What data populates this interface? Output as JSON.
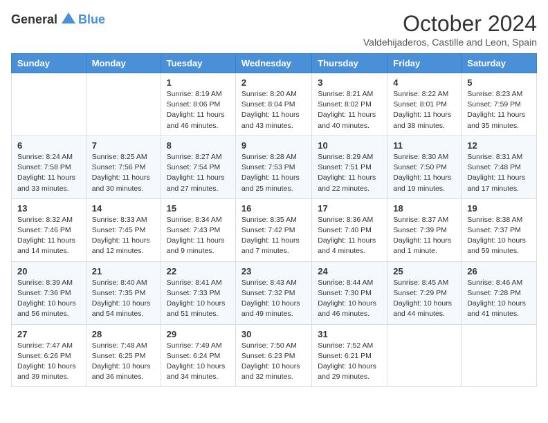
{
  "logo": {
    "general": "General",
    "blue": "Blue"
  },
  "header": {
    "title": "October 2024",
    "subtitle": "Valdehijaderos, Castille and Leon, Spain"
  },
  "days_of_week": [
    "Sunday",
    "Monday",
    "Tuesday",
    "Wednesday",
    "Thursday",
    "Friday",
    "Saturday"
  ],
  "weeks": [
    [
      {
        "day": "",
        "sunrise": "",
        "sunset": "",
        "daylight": ""
      },
      {
        "day": "",
        "sunrise": "",
        "sunset": "",
        "daylight": ""
      },
      {
        "day": "1",
        "sunrise": "Sunrise: 8:19 AM",
        "sunset": "Sunset: 8:06 PM",
        "daylight": "Daylight: 11 hours and 46 minutes."
      },
      {
        "day": "2",
        "sunrise": "Sunrise: 8:20 AM",
        "sunset": "Sunset: 8:04 PM",
        "daylight": "Daylight: 11 hours and 43 minutes."
      },
      {
        "day": "3",
        "sunrise": "Sunrise: 8:21 AM",
        "sunset": "Sunset: 8:02 PM",
        "daylight": "Daylight: 11 hours and 40 minutes."
      },
      {
        "day": "4",
        "sunrise": "Sunrise: 8:22 AM",
        "sunset": "Sunset: 8:01 PM",
        "daylight": "Daylight: 11 hours and 38 minutes."
      },
      {
        "day": "5",
        "sunrise": "Sunrise: 8:23 AM",
        "sunset": "Sunset: 7:59 PM",
        "daylight": "Daylight: 11 hours and 35 minutes."
      }
    ],
    [
      {
        "day": "6",
        "sunrise": "Sunrise: 8:24 AM",
        "sunset": "Sunset: 7:58 PM",
        "daylight": "Daylight: 11 hours and 33 minutes."
      },
      {
        "day": "7",
        "sunrise": "Sunrise: 8:25 AM",
        "sunset": "Sunset: 7:56 PM",
        "daylight": "Daylight: 11 hours and 30 minutes."
      },
      {
        "day": "8",
        "sunrise": "Sunrise: 8:27 AM",
        "sunset": "Sunset: 7:54 PM",
        "daylight": "Daylight: 11 hours and 27 minutes."
      },
      {
        "day": "9",
        "sunrise": "Sunrise: 8:28 AM",
        "sunset": "Sunset: 7:53 PM",
        "daylight": "Daylight: 11 hours and 25 minutes."
      },
      {
        "day": "10",
        "sunrise": "Sunrise: 8:29 AM",
        "sunset": "Sunset: 7:51 PM",
        "daylight": "Daylight: 11 hours and 22 minutes."
      },
      {
        "day": "11",
        "sunrise": "Sunrise: 8:30 AM",
        "sunset": "Sunset: 7:50 PM",
        "daylight": "Daylight: 11 hours and 19 minutes."
      },
      {
        "day": "12",
        "sunrise": "Sunrise: 8:31 AM",
        "sunset": "Sunset: 7:48 PM",
        "daylight": "Daylight: 11 hours and 17 minutes."
      }
    ],
    [
      {
        "day": "13",
        "sunrise": "Sunrise: 8:32 AM",
        "sunset": "Sunset: 7:46 PM",
        "daylight": "Daylight: 11 hours and 14 minutes."
      },
      {
        "day": "14",
        "sunrise": "Sunrise: 8:33 AM",
        "sunset": "Sunset: 7:45 PM",
        "daylight": "Daylight: 11 hours and 12 minutes."
      },
      {
        "day": "15",
        "sunrise": "Sunrise: 8:34 AM",
        "sunset": "Sunset: 7:43 PM",
        "daylight": "Daylight: 11 hours and 9 minutes."
      },
      {
        "day": "16",
        "sunrise": "Sunrise: 8:35 AM",
        "sunset": "Sunset: 7:42 PM",
        "daylight": "Daylight: 11 hours and 7 minutes."
      },
      {
        "day": "17",
        "sunrise": "Sunrise: 8:36 AM",
        "sunset": "Sunset: 7:40 PM",
        "daylight": "Daylight: 11 hours and 4 minutes."
      },
      {
        "day": "18",
        "sunrise": "Sunrise: 8:37 AM",
        "sunset": "Sunset: 7:39 PM",
        "daylight": "Daylight: 11 hours and 1 minute."
      },
      {
        "day": "19",
        "sunrise": "Sunrise: 8:38 AM",
        "sunset": "Sunset: 7:37 PM",
        "daylight": "Daylight: 10 hours and 59 minutes."
      }
    ],
    [
      {
        "day": "20",
        "sunrise": "Sunrise: 8:39 AM",
        "sunset": "Sunset: 7:36 PM",
        "daylight": "Daylight: 10 hours and 56 minutes."
      },
      {
        "day": "21",
        "sunrise": "Sunrise: 8:40 AM",
        "sunset": "Sunset: 7:35 PM",
        "daylight": "Daylight: 10 hours and 54 minutes."
      },
      {
        "day": "22",
        "sunrise": "Sunrise: 8:41 AM",
        "sunset": "Sunset: 7:33 PM",
        "daylight": "Daylight: 10 hours and 51 minutes."
      },
      {
        "day": "23",
        "sunrise": "Sunrise: 8:43 AM",
        "sunset": "Sunset: 7:32 PM",
        "daylight": "Daylight: 10 hours and 49 minutes."
      },
      {
        "day": "24",
        "sunrise": "Sunrise: 8:44 AM",
        "sunset": "Sunset: 7:30 PM",
        "daylight": "Daylight: 10 hours and 46 minutes."
      },
      {
        "day": "25",
        "sunrise": "Sunrise: 8:45 AM",
        "sunset": "Sunset: 7:29 PM",
        "daylight": "Daylight: 10 hours and 44 minutes."
      },
      {
        "day": "26",
        "sunrise": "Sunrise: 8:46 AM",
        "sunset": "Sunset: 7:28 PM",
        "daylight": "Daylight: 10 hours and 41 minutes."
      }
    ],
    [
      {
        "day": "27",
        "sunrise": "Sunrise: 7:47 AM",
        "sunset": "Sunset: 6:26 PM",
        "daylight": "Daylight: 10 hours and 39 minutes."
      },
      {
        "day": "28",
        "sunrise": "Sunrise: 7:48 AM",
        "sunset": "Sunset: 6:25 PM",
        "daylight": "Daylight: 10 hours and 36 minutes."
      },
      {
        "day": "29",
        "sunrise": "Sunrise: 7:49 AM",
        "sunset": "Sunset: 6:24 PM",
        "daylight": "Daylight: 10 hours and 34 minutes."
      },
      {
        "day": "30",
        "sunrise": "Sunrise: 7:50 AM",
        "sunset": "Sunset: 6:23 PM",
        "daylight": "Daylight: 10 hours and 32 minutes."
      },
      {
        "day": "31",
        "sunrise": "Sunrise: 7:52 AM",
        "sunset": "Sunset: 6:21 PM",
        "daylight": "Daylight: 10 hours and 29 minutes."
      },
      {
        "day": "",
        "sunrise": "",
        "sunset": "",
        "daylight": ""
      },
      {
        "day": "",
        "sunrise": "",
        "sunset": "",
        "daylight": ""
      }
    ]
  ]
}
